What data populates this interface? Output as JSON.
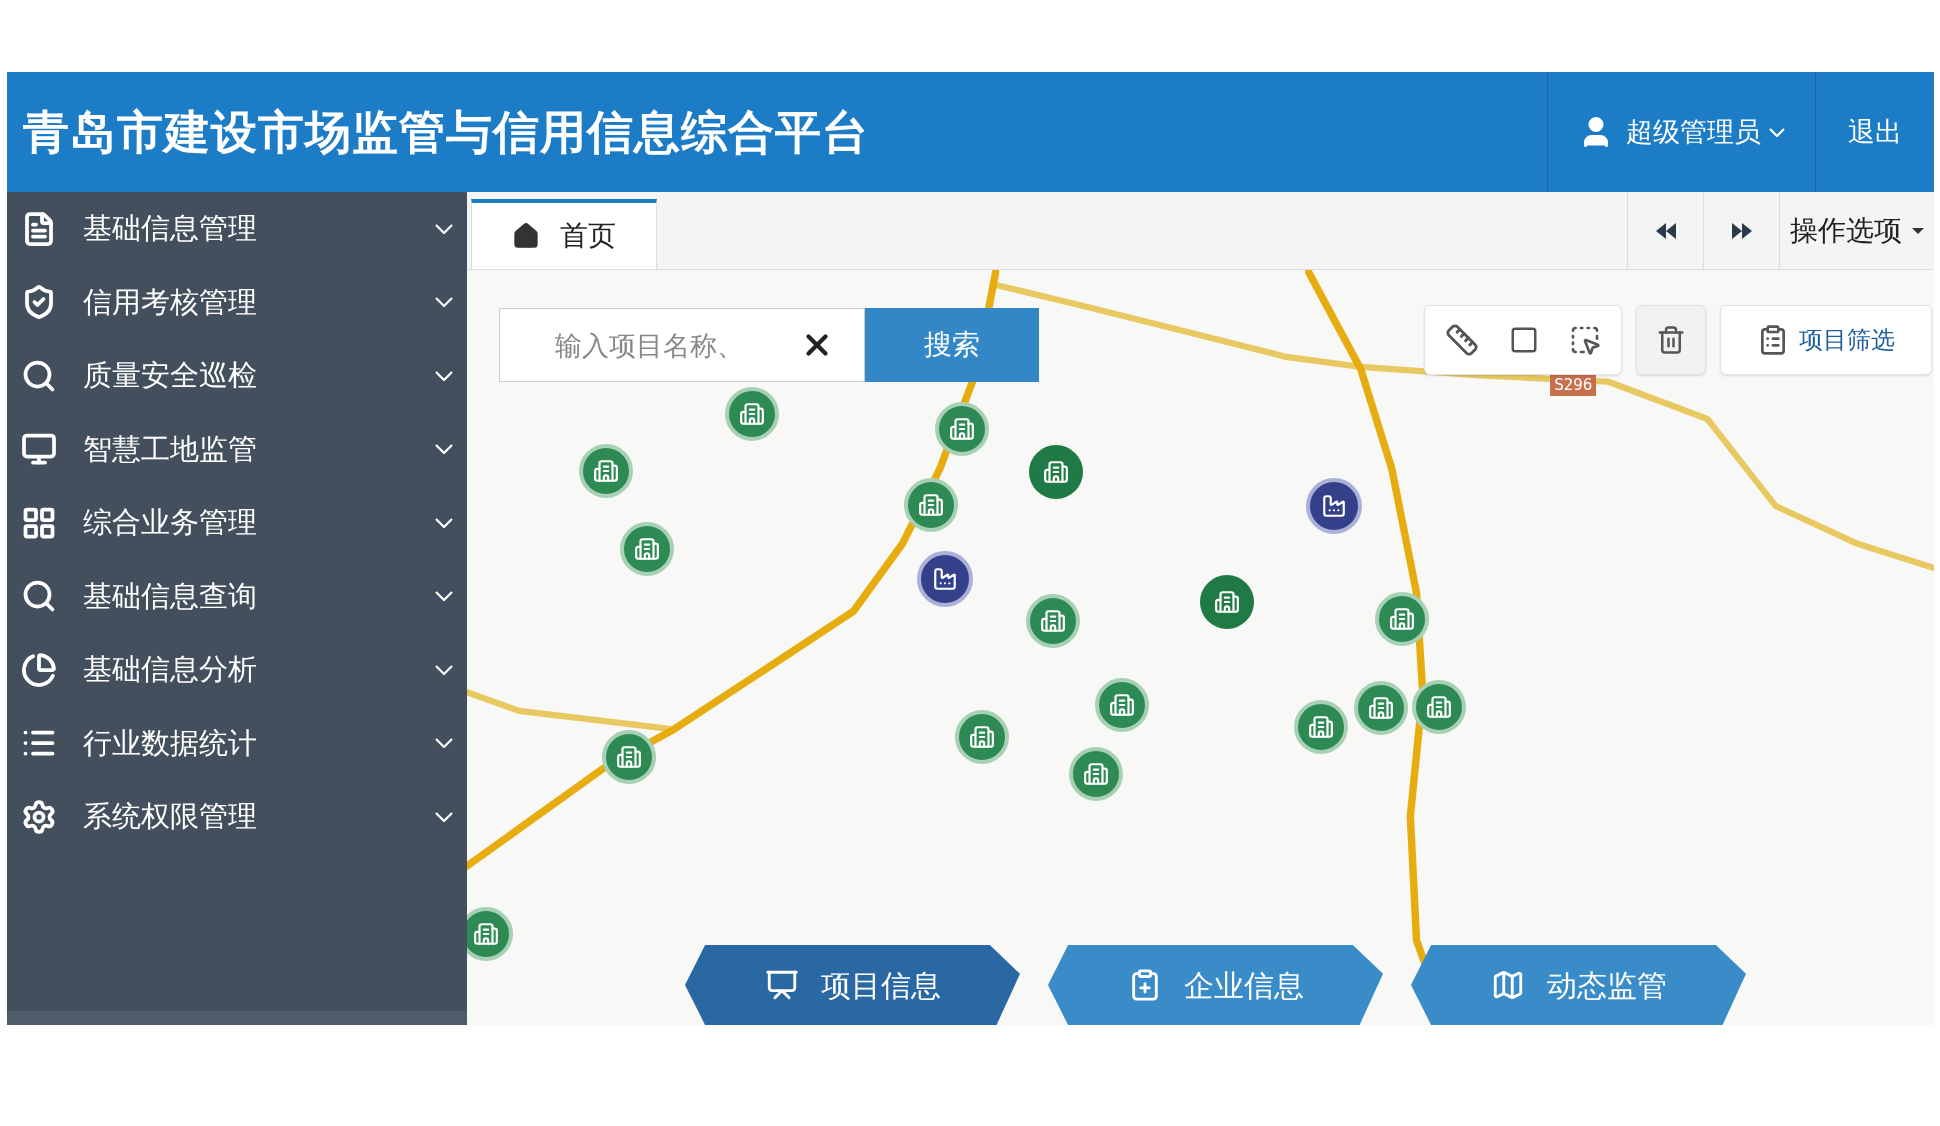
{
  "header": {
    "title": "青岛市建设市场监管与信用信息综合平台",
    "user": "超级管理员",
    "logout": "退出"
  },
  "sidebar": {
    "items": [
      {
        "label": "基础信息管理",
        "expanded": false
      },
      {
        "label": "信用考核管理",
        "expanded": false
      },
      {
        "label": "质量安全巡检",
        "expanded": false
      },
      {
        "label": "智慧工地监管",
        "expanded": false
      },
      {
        "label": "综合业务管理",
        "expanded": false
      },
      {
        "label": "基础信息查询",
        "expanded": false
      },
      {
        "label": "基础信息分析",
        "expanded": false
      },
      {
        "label": "行业数据统计",
        "expanded": false
      },
      {
        "label": "系统权限管理",
        "expanded": false
      }
    ]
  },
  "tabs": [
    {
      "label": "首页",
      "selected": true
    }
  ],
  "tab_options": "操作选项",
  "search": {
    "placeholder": "输入项目名称、",
    "button": "搜索"
  },
  "map": {
    "road_label": "S296",
    "filter_button": "项目筛选"
  },
  "bottom_buttons": [
    {
      "label": "项目信息",
      "selected": true
    },
    {
      "label": "企业信息",
      "selected": false
    },
    {
      "label": "动态监管",
      "selected": false
    }
  ]
}
